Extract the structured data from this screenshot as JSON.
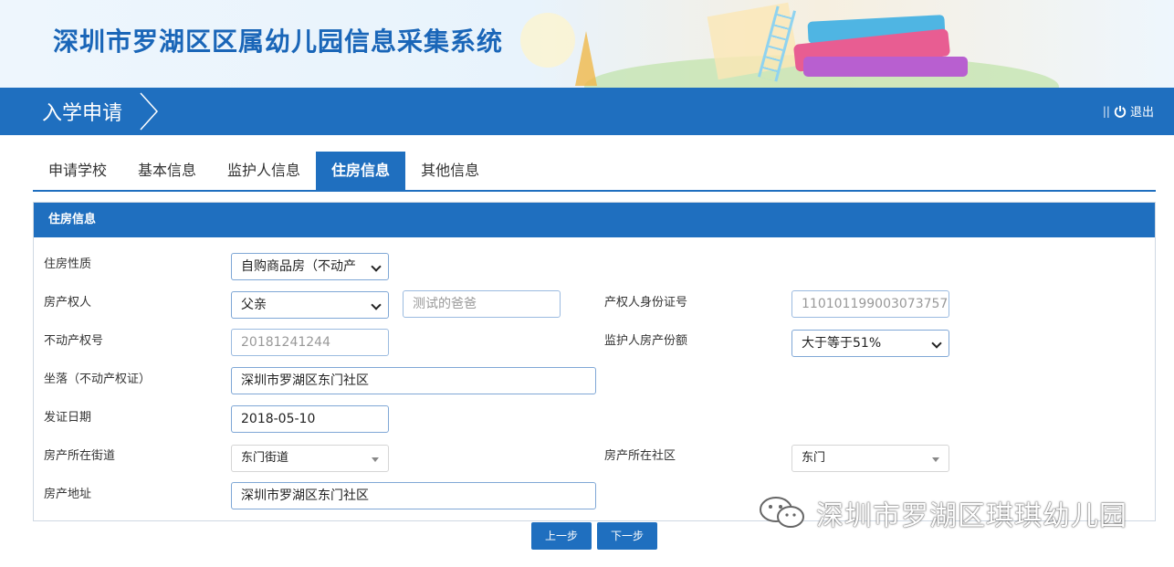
{
  "header": {
    "system_title": "深圳市罗湖区区属幼儿园信息采集系统"
  },
  "navbar": {
    "breadcrumb": "入学申请",
    "logout_sep": "||",
    "logout_label": "退出"
  },
  "tabs": [
    {
      "label": "申请学校",
      "active": false
    },
    {
      "label": "基本信息",
      "active": false
    },
    {
      "label": "监护人信息",
      "active": false
    },
    {
      "label": "住房信息",
      "active": true
    },
    {
      "label": "其他信息",
      "active": false
    }
  ],
  "panel": {
    "title": "住房信息"
  },
  "form": {
    "housing_type": {
      "label": "住房性质",
      "value": "自购商品房（不动产"
    },
    "owner": {
      "label": "房产权人",
      "value": "父亲"
    },
    "owner_name": {
      "placeholder": "测试的爸爸"
    },
    "owner_id": {
      "label": "产权人身份证号",
      "value": "110101199003073757"
    },
    "property_no": {
      "label": "不动产权号",
      "value": "20181241244"
    },
    "guardian_share": {
      "label": "监护人房产份额",
      "value": "大于等于51%"
    },
    "location": {
      "label": "坐落（不动产权证）",
      "value": "深圳市罗湖区东门社区"
    },
    "issue_date": {
      "label": "发证日期",
      "value": "2018-05-10"
    },
    "street": {
      "label": "房产所在街道",
      "value": "东门街道"
    },
    "community": {
      "label": "房产所在社区",
      "value": "东门"
    },
    "address": {
      "label": "房产地址",
      "value": "深圳市罗湖区东门社区"
    }
  },
  "buttons": {
    "prev": "上一步",
    "next": "下一步"
  },
  "watermark": {
    "text": "深圳市罗湖区琪琪幼儿园"
  },
  "colors": {
    "primary": "#1f6fbf",
    "title": "#1a66b8"
  }
}
